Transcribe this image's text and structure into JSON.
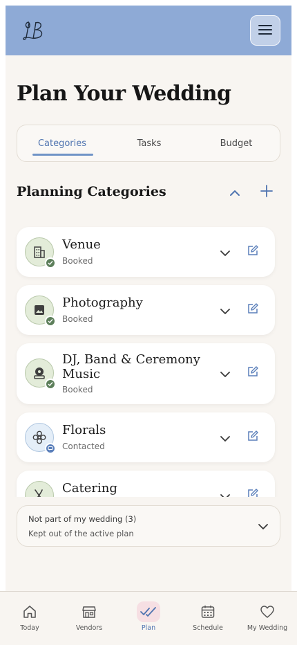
{
  "header": {
    "logo_text": "LB"
  },
  "page": {
    "title": "Plan Your Wedding"
  },
  "tabs": [
    {
      "label": "Categories",
      "active": true
    },
    {
      "label": "Tasks",
      "active": false
    },
    {
      "label": "Budget",
      "active": false
    }
  ],
  "section": {
    "title": "Planning Categories"
  },
  "categories": [
    {
      "name": "Venue",
      "status": "Booked",
      "icon": "building-icon",
      "status_icon": "check-icon"
    },
    {
      "name": "Photography",
      "status": "Booked",
      "icon": "image-icon",
      "status_icon": "check-icon"
    },
    {
      "name": "DJ, Band & Ceremony Music",
      "status": "Booked",
      "icon": "speaker-icon",
      "status_icon": "check-icon"
    },
    {
      "name": "Florals",
      "status": "Contacted",
      "icon": "flower-icon",
      "status_icon": "chat-icon"
    },
    {
      "name": "Catering",
      "status": "",
      "icon": "fork-knife-icon",
      "status_icon": ""
    }
  ],
  "not_part": {
    "title": "Not part of my wedding (3)",
    "subtitle": "Kept out of the active plan"
  },
  "nav": [
    {
      "label": "Today",
      "icon": "home-icon",
      "active": false
    },
    {
      "label": "Vendors",
      "icon": "store-icon",
      "active": false
    },
    {
      "label": "Plan",
      "icon": "double-check-icon",
      "active": true
    },
    {
      "label": "Schedule",
      "icon": "calendar-icon",
      "active": false
    },
    {
      "label": "My Wedding",
      "icon": "heart-icon",
      "active": false
    }
  ],
  "colors": {
    "header": "#8eaad6",
    "accent": "#4f74b0",
    "booked": "#5d7f5b",
    "contacted": "#5a7fba",
    "background": "#f8f5f1"
  }
}
